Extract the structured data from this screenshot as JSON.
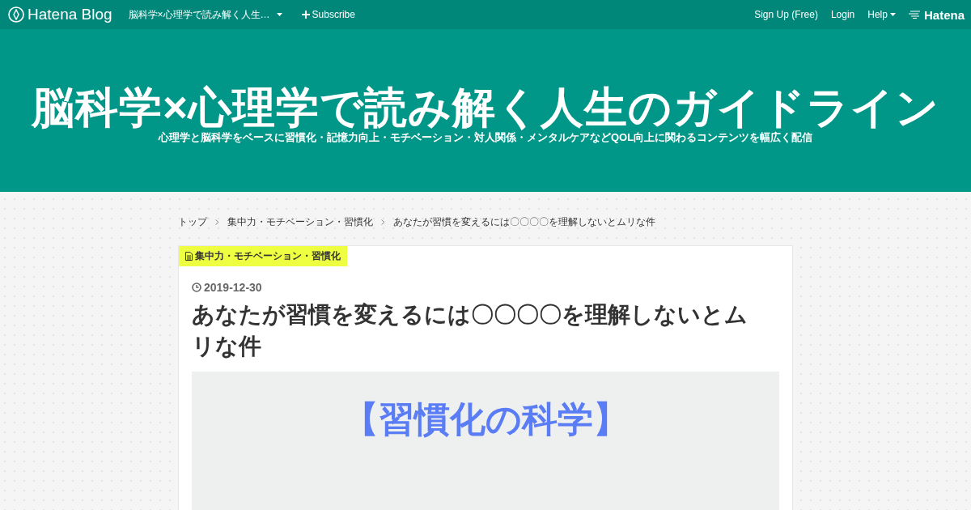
{
  "topbar": {
    "logo": "Hatena Blog",
    "blog_menu": "脳科学×心理学で読み解く人生…",
    "subscribe": "Subscribe",
    "links": [
      "Sign Up (Free)",
      "Login",
      "Help"
    ],
    "brand": "Hatena"
  },
  "header": {
    "title": "脳科学×心理学で読み解く人生のガイドライン",
    "description": "心理学と脳科学をベースに習慣化・記憶力向上・モチベーション・対人関係・メンタルケアなどQOL向上に関わるコンテンツを幅広く配信"
  },
  "breadcrumb": [
    "トップ",
    "集中力・モチベーション・習慣化",
    "あなたが習慣を変えるには〇〇〇〇を理解しないとムリな件"
  ],
  "article": {
    "category": "集中力・モチベーション・習慣化",
    "date": "2019-12-30",
    "title": "あなたが習慣を変えるには〇〇〇〇を理解しないとムリな件",
    "eyecatch": {
      "heading": "【習慣化の科学】"
    }
  }
}
